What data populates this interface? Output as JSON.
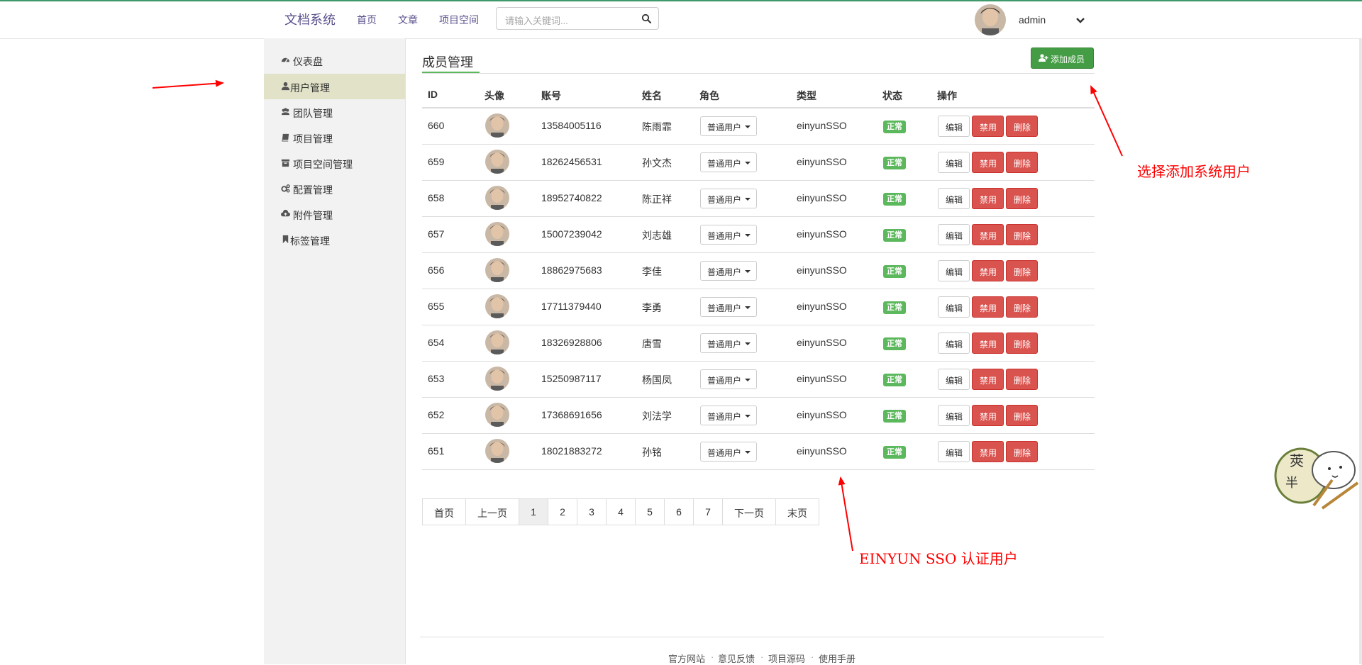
{
  "navbar": {
    "brand": "文档系统",
    "links": [
      "首页",
      "文章",
      "项目空间"
    ],
    "search_placeholder": "请输入关键词...",
    "user_name": "admin"
  },
  "sidebar": {
    "items": [
      {
        "label": "仪表盘",
        "icon": "dashboard-icon",
        "active": false
      },
      {
        "label": "用户管理",
        "icon": "user-icon",
        "active": true
      },
      {
        "label": "团队管理",
        "icon": "users-icon",
        "active": false
      },
      {
        "label": "项目管理",
        "icon": "book-icon",
        "active": false
      },
      {
        "label": "项目空间管理",
        "icon": "archive-icon",
        "active": false
      },
      {
        "label": "配置管理",
        "icon": "cogs-icon",
        "active": false
      },
      {
        "label": "附件管理",
        "icon": "cloud-upload-icon",
        "active": false
      },
      {
        "label": "标签管理",
        "icon": "bookmark-icon",
        "active": false
      }
    ]
  },
  "main": {
    "title": "成员管理",
    "add_button": "添加成员",
    "columns": [
      "ID",
      "头像",
      "账号",
      "姓名",
      "角色",
      "类型",
      "状态",
      "操作"
    ],
    "rows": [
      {
        "id": "660",
        "account": "13584005116",
        "name": "陈雨霏",
        "role": "普通用户",
        "type": "einyunSSO",
        "status": "正常"
      },
      {
        "id": "659",
        "account": "18262456531",
        "name": "孙文杰",
        "role": "普通用户",
        "type": "einyunSSO",
        "status": "正常"
      },
      {
        "id": "658",
        "account": "18952740822",
        "name": "陈正祥",
        "role": "普通用户",
        "type": "einyunSSO",
        "status": "正常"
      },
      {
        "id": "657",
        "account": "15007239042",
        "name": "刘志雄",
        "role": "普通用户",
        "type": "einyunSSO",
        "status": "正常"
      },
      {
        "id": "656",
        "account": "18862975683",
        "name": "李佳",
        "role": "普通用户",
        "type": "einyunSSO",
        "status": "正常"
      },
      {
        "id": "655",
        "account": "17711379440",
        "name": "李勇",
        "role": "普通用户",
        "type": "einyunSSO",
        "status": "正常"
      },
      {
        "id": "654",
        "account": "18326928806",
        "name": "唐雪",
        "role": "普通用户",
        "type": "einyunSSO",
        "status": "正常"
      },
      {
        "id": "653",
        "account": "15250987117",
        "name": "杨国凤",
        "role": "普通用户",
        "type": "einyunSSO",
        "status": "正常"
      },
      {
        "id": "652",
        "account": "17368691656",
        "name": "刘法学",
        "role": "普通用户",
        "type": "einyunSSO",
        "status": "正常"
      },
      {
        "id": "651",
        "account": "18021883272",
        "name": "孙铭",
        "role": "普通用户",
        "type": "einyunSSO",
        "status": "正常"
      }
    ],
    "actions": {
      "edit": "编辑",
      "disable": "禁用",
      "delete": "删除"
    },
    "pagination": [
      "首页",
      "上一页",
      "1",
      "2",
      "3",
      "4",
      "5",
      "6",
      "7",
      "下一页",
      "末页"
    ],
    "current_page": "1"
  },
  "footer": {
    "links": [
      "官方网站",
      "意见反馈",
      "项目源码",
      "使用手册"
    ],
    "separator": "·"
  },
  "annotations": {
    "add_user_note": "选择添加系统用户",
    "sso_note": "EINYUN SSO 认证用户",
    "sticker_text_1": "莢",
    "sticker_text_2": "半"
  },
  "colors": {
    "brand": "#5a4f8c",
    "success": "#5cb85c",
    "danger": "#d9534f",
    "annotation": "#ff0000",
    "sidebar_active": "#e2e2c8"
  }
}
